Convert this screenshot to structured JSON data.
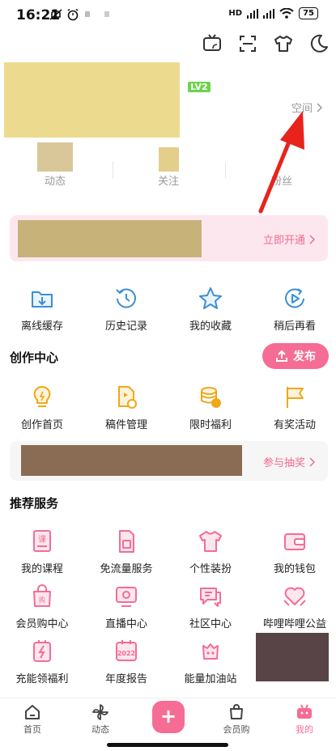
{
  "status_bar": {
    "time": "16:21",
    "network": "HD",
    "battery": "75"
  },
  "profile": {
    "level_badge": "LV2",
    "space_link": "空间",
    "stats": [
      {
        "label": "动态"
      },
      {
        "label": "关注"
      },
      {
        "label": "粉丝"
      }
    ]
  },
  "vip_banner": {
    "action": "立即开通"
  },
  "quick_actions": [
    {
      "label": "离线缓存",
      "icon": "download-folder-icon"
    },
    {
      "label": "历史记录",
      "icon": "history-clock-icon"
    },
    {
      "label": "我的收藏",
      "icon": "star-icon"
    },
    {
      "label": "稍后再看",
      "icon": "watch-later-icon"
    }
  ],
  "creation_center": {
    "title": "创作中心",
    "publish_label": "发布",
    "items": [
      {
        "label": "创作首页",
        "icon": "bulb-icon"
      },
      {
        "label": "稿件管理",
        "icon": "manuscript-icon"
      },
      {
        "label": "限时福利",
        "icon": "coins-icon"
      },
      {
        "label": "有奖活动",
        "icon": "flag-icon"
      }
    ]
  },
  "lottery_banner": {
    "action": "参与抽奖"
  },
  "recommended": {
    "title": "推荐服务",
    "items": [
      {
        "label": "我的课程",
        "icon": "course-book-icon"
      },
      {
        "label": "免流量服务",
        "icon": "sim-card-icon"
      },
      {
        "label": "个性装扮",
        "icon": "tshirt-icon"
      },
      {
        "label": "我的钱包",
        "icon": "wallet-icon"
      },
      {
        "label": "会员购中心",
        "icon": "shopping-bag-icon"
      },
      {
        "label": "直播中心",
        "icon": "live-tv-icon"
      },
      {
        "label": "社区中心",
        "icon": "chat-bubbles-icon"
      },
      {
        "label": "哔哩哔哩公益",
        "icon": "charity-heart-icon"
      },
      {
        "label": "充能领福利",
        "icon": "energy-bolt-icon"
      },
      {
        "label": "年度报告",
        "icon": "report-2022-icon"
      },
      {
        "label": "能量加油站",
        "icon": "energy-station-icon"
      }
    ]
  },
  "tabbar": {
    "items": [
      {
        "label": "首页"
      },
      {
        "label": "动态"
      },
      {
        "label": "会员购"
      },
      {
        "label": "我的"
      }
    ]
  },
  "colors": {
    "accent": "#f56c95",
    "vip_bg": "#fde7ee",
    "icon_blue": "#3a8fd6",
    "icon_yellow": "#f0a818"
  }
}
